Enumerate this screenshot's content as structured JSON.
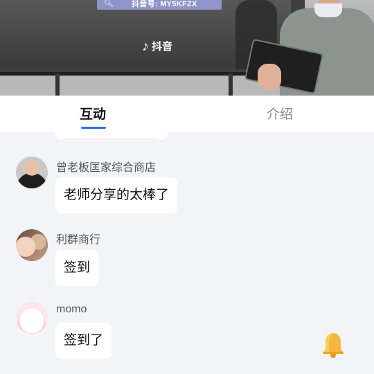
{
  "video": {
    "screen_search_text": "抖音号: MY5KFZX",
    "tiktok_label": "抖音"
  },
  "tabs": [
    {
      "label": "互动",
      "active": true
    },
    {
      "label": "介绍",
      "active": false
    }
  ],
  "messages": [
    {
      "name": "曾老板匡家综合商店",
      "text": "老师分享的太棒了"
    },
    {
      "name": "利群商行",
      "text": "签到"
    },
    {
      "name": "momo",
      "text": "签到了"
    }
  ],
  "colors": {
    "accent": "#2d6fe6",
    "bell": "#f6b73c"
  },
  "icons": {
    "bell": "bell-icon",
    "search": "search-icon",
    "tiktok": "tiktok-icon"
  }
}
